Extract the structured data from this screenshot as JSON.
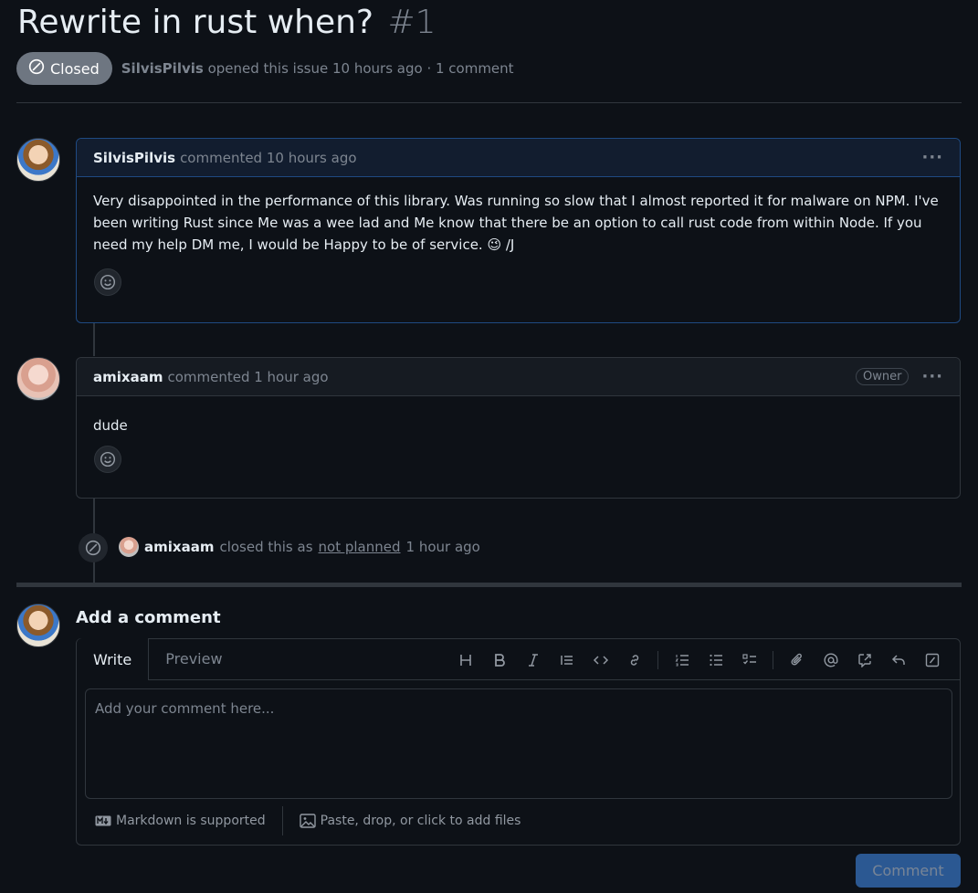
{
  "issue": {
    "title": "Rewrite in rust when?",
    "number": "#1",
    "state": "Closed",
    "author": "SilvisPilvis",
    "meta_text": "opened this issue 10 hours ago · 1 comment"
  },
  "comments": [
    {
      "author": "SilvisPilvis",
      "action": "commented 10 hours ago",
      "body": "Very disappointed in the performance of this library. Was running so slow that I almost reported it for malware on NPM. I've been writing Rust since Me was a wee lad and Me know that there be an option to call rust code from within Node. If you need my help DM me, I would be Happy to be of service. 😉 /J",
      "menu": "···"
    },
    {
      "author": "amixaam",
      "action": "commented 1 hour ago",
      "badge": "Owner",
      "body": "dude",
      "menu": "···"
    }
  ],
  "event": {
    "actor": "amixaam",
    "text_before": "closed this as",
    "link": "not planned",
    "text_after": "1 hour ago"
  },
  "composer": {
    "title": "Add a comment",
    "tabs": [
      "Write",
      "Preview"
    ],
    "placeholder": "Add your comment here...",
    "markdown_note": "Markdown is supported",
    "files_note": "Paste, drop, or click to add files",
    "submit_label": "Comment",
    "toolbar_icons": [
      "heading-icon",
      "bold-icon",
      "italic-icon",
      "quote-icon",
      "code-icon",
      "link-icon",
      "ordered-list-icon",
      "unordered-list-icon",
      "task-list-icon",
      "attach-icon",
      "mention-icon",
      "reference-icon",
      "reply-icon",
      "slash-command-icon"
    ]
  },
  "colors": {
    "background": "#0d1117",
    "accent": "#4493f8",
    "closed_badge": "#6e7681",
    "border": "#30363d"
  }
}
